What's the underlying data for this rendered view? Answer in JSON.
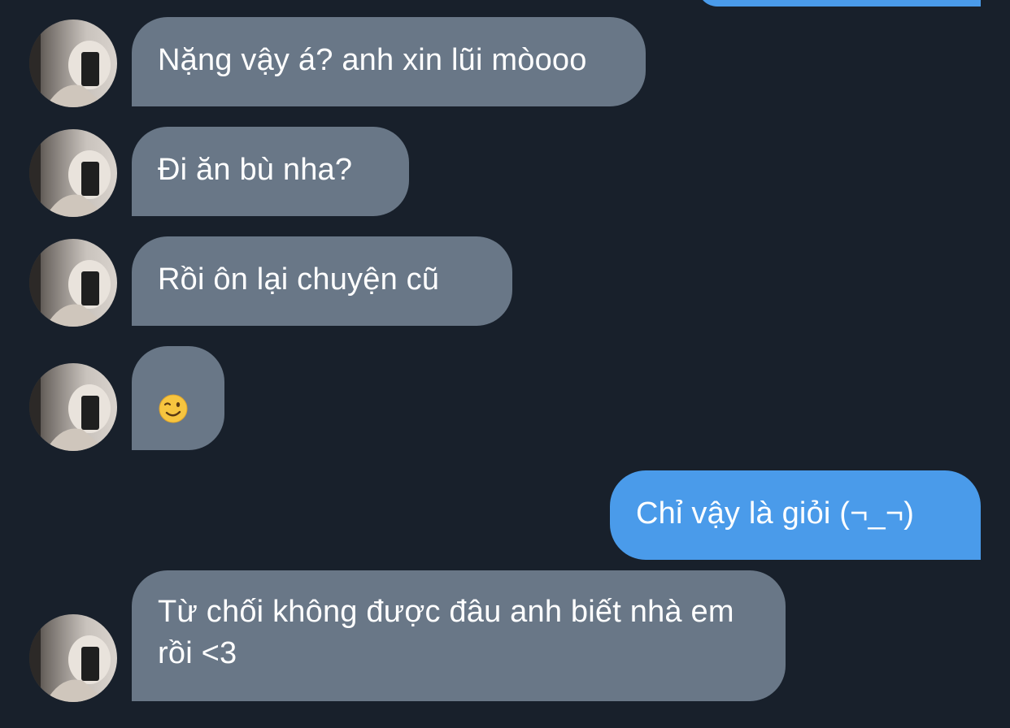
{
  "conversation": {
    "messages": [
      {
        "id": "m1",
        "direction": "incoming",
        "text": "Nặng vậy á? anh xin lũi mòooo"
      },
      {
        "id": "m2",
        "direction": "incoming",
        "text": "Đi ăn bù nha?"
      },
      {
        "id": "m3",
        "direction": "incoming",
        "text": "Rồi ôn lại chuyện cũ"
      },
      {
        "id": "m4",
        "direction": "incoming",
        "emoji": "winking-face"
      },
      {
        "id": "m5",
        "direction": "outgoing",
        "text": "Chỉ vậy là giỏi (¬_¬)"
      },
      {
        "id": "m6",
        "direction": "incoming",
        "text": "Từ chối không được đâu anh biết nhà em rồi <3"
      }
    ]
  },
  "colors": {
    "background": "#18202b",
    "incoming_bubble": "#697787",
    "outgoing_bubble": "#4a9bea",
    "text": "#ffffff"
  }
}
